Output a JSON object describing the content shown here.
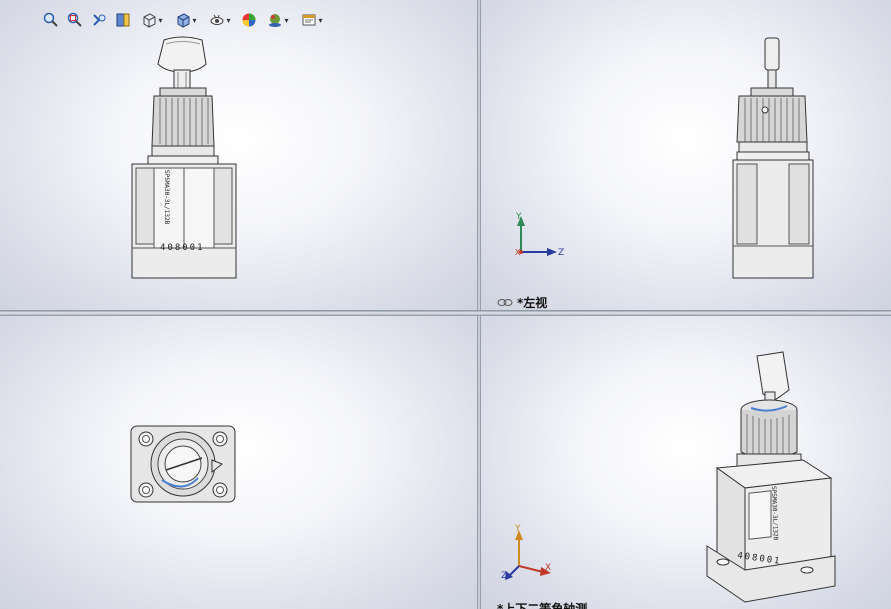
{
  "toolbar": {
    "buttons": [
      {
        "icon": "zoom-to-fit-icon"
      },
      {
        "icon": "zoom-to-area-icon"
      },
      {
        "icon": "previous-view-icon"
      },
      {
        "icon": "section-view-icon"
      },
      {
        "icon": "view-orientation-icon",
        "dropdown": true
      },
      {
        "icon": "display-style-icon",
        "dropdown": true
      },
      {
        "icon": "hide-show-items-icon",
        "dropdown": true
      },
      {
        "icon": "edit-appearance-icon"
      },
      {
        "icon": "apply-scene-icon",
        "dropdown": true
      },
      {
        "icon": "view-settings-icon",
        "dropdown": true
      }
    ]
  },
  "views": {
    "top_right": {
      "name": "*左视"
    },
    "bottom_right": {
      "name": "*上下二等角轴测"
    }
  },
  "triad": {
    "x": "X",
    "y": "Y",
    "z": "Z"
  },
  "part": {
    "model_text": "SPSMA30-3L/132B",
    "serial": "408001"
  },
  "colors": {
    "axis_x": "#c0392b",
    "axis_y": "#2e8b57",
    "axis_z": "#2b3a9e",
    "viewport_center": "#ffffff",
    "viewport_edge": "#cfd3e0"
  }
}
